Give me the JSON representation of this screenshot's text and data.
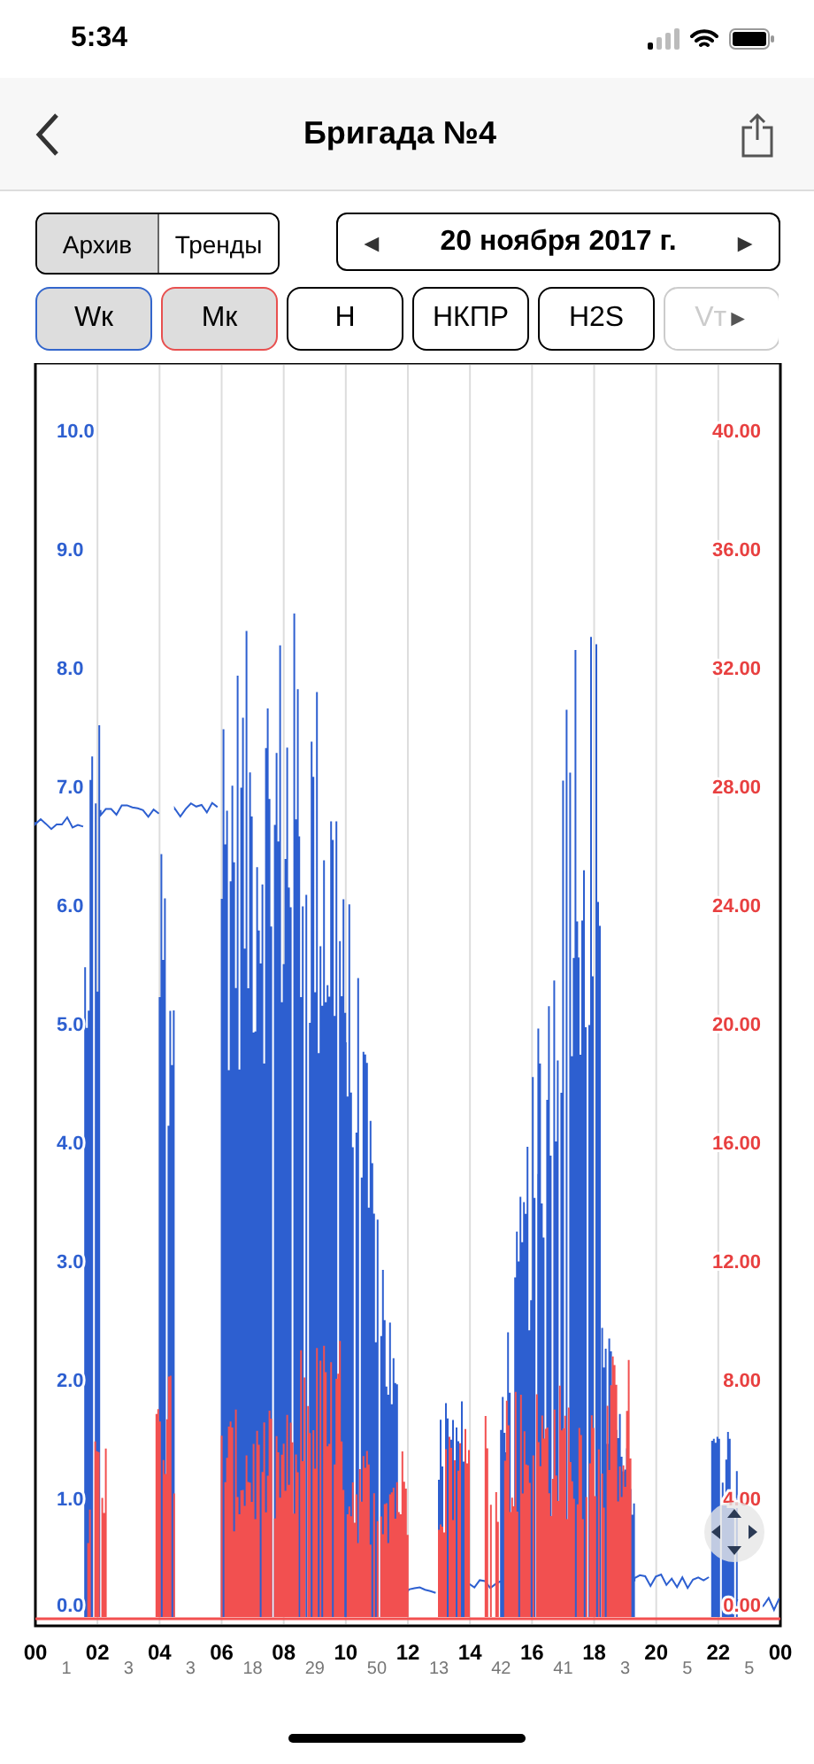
{
  "status_bar": {
    "time": "5:34"
  },
  "nav": {
    "title": "Бригада №4"
  },
  "mode_tabs": [
    {
      "label": "Архив",
      "selected": true
    },
    {
      "label": "Тренды",
      "selected": false
    }
  ],
  "date": {
    "prev": "◄",
    "label": "20 ноября 2017 г.",
    "next": "►"
  },
  "channels": [
    {
      "label": "Wк",
      "selected": true,
      "disabled": false,
      "color": "#3366cc"
    },
    {
      "label": "Мк",
      "selected": true,
      "disabled": false,
      "color": "#e8504f"
    },
    {
      "label": "Н",
      "selected": false,
      "disabled": false
    },
    {
      "label": "НКПР",
      "selected": false,
      "disabled": false
    },
    {
      "label": "H2S",
      "selected": false,
      "disabled": false
    },
    {
      "label": "Vт",
      "selected": false,
      "disabled": true,
      "arrow": "►"
    }
  ],
  "chart": {
    "left_axis": [
      "10.0",
      "9.0",
      "8.0",
      "7.0",
      "6.0",
      "5.0",
      "4.0",
      "3.0",
      "2.0",
      "1.0",
      "0.0"
    ],
    "right_axis": [
      "40.00",
      "36.00",
      "32.00",
      "28.00",
      "24.00",
      "20.00",
      "16.00",
      "12.00",
      "8.00",
      "4.00",
      "0.00"
    ],
    "hours": [
      "00",
      "02",
      "04",
      "06",
      "08",
      "10",
      "12",
      "14",
      "16",
      "18",
      "20",
      "22",
      "00"
    ],
    "counts": [
      "1",
      "3",
      "3",
      "18",
      "29",
      "50",
      "13",
      "42",
      "41",
      "3",
      "5",
      "5"
    ]
  }
}
